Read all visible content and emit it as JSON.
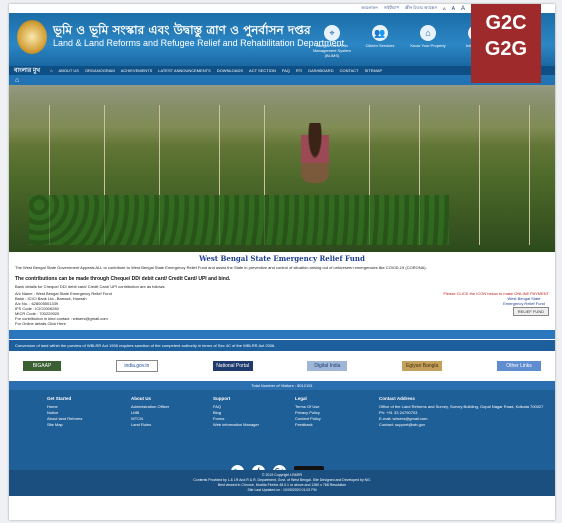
{
  "top_strip": [
    "অবলোকন",
    "সাইটম্যাপ",
    "স্ক্রীন রিডার অ্যাক্সেস",
    "A",
    "A",
    "A"
  ],
  "header": {
    "title_bn": "ভূমি ও ভূমি সংস্কার এবং উদ্বাস্তু ত্রাণ ও পুনর্বাসন দপ্তর",
    "title_en": "Land & Land Reforms and Refugee Relief and Rehabilitation Department",
    "links": [
      {
        "label": "Banglar Land Info Management System (BLIMS)",
        "icon": "map-icon"
      },
      {
        "label": "Citizen Services",
        "icon": "people-icon"
      },
      {
        "label": "Know Your Property",
        "icon": "home-icon"
      },
      {
        "label": "Information",
        "icon": "info-icon"
      }
    ]
  },
  "badge": {
    "line1": "G2C",
    "line2": "G2G"
  },
  "nav": {
    "brand": "বাংলার মুখ",
    "items": [
      "ABOUT US",
      "ORGANOGRAM",
      "ACHIEVEMENTS",
      "LATEST ANNOUNCEMENTS",
      "DOWNLOADS",
      "ACT SECTION",
      "FAQ",
      "RTI",
      "DASHBOARD",
      "CONTACT",
      "SITEMAP"
    ]
  },
  "hero": {
    "caption": "West Bengal State Emergency Relief Fund"
  },
  "relief": {
    "intro": "The West Bengal State Government Appeals ALL to contribute to West Bengal State Emergency Relief Fund and assist the State in preventive and control of situation arising out of unforeseen emergencies like COVID-19 (CORONA).",
    "contrib": "The contributions can be made through Cheque/ DD/ debit card/ Credit Card/ UPI and bind.",
    "bank_head": "Bank details for Cheque/ DD/ debit card/ Credit Card/ UPI contribution are as follows:",
    "bank_lines": [
      "A/c Name   : West Bengal State Emergency Relief Fund",
      "Bank        : ICICI Bank Ltd., Barrack, Howrah",
      "A/c No.     : 628005501339",
      "IFS Code   : ICIC0006280",
      "MICR Code  : 700229020",
      "For contribution in kind contact : wbsers@gmail.com",
      "For Online details Click Here"
    ],
    "online_note": "Please CLICK the ICON below to make ONLINE PAYMENT",
    "online_box": "West Bengal State Emergency Relief Fund",
    "donate_label": "RELIEF FUND"
  },
  "notice": "Conversion of land within the purview of WBLRR Act 1955 requires sanction of the competent authority in terms of Sec 4C of the WBLRR Act 2006.",
  "logos": [
    "BIGAAP",
    "india.gov.in",
    "National Portal",
    "Digital India",
    "Egiyan Bangla",
    "Other Links"
  ],
  "visitors": "Total Number of Visitors : 5012151",
  "footer": {
    "columns": [
      {
        "head": "Get Started",
        "items": [
          "Home",
          "Notice",
          "About land Reforms",
          "Site Map"
        ]
      },
      {
        "head": "About Us",
        "items": [
          "Administration Officer",
          "LMB",
          "WTCN",
          "Land Rules"
        ]
      },
      {
        "head": "Support",
        "items": [
          "FAQ",
          "Blog",
          "Forms",
          "Web information Manager"
        ]
      },
      {
        "head": "Legal",
        "items": [
          "Terms Of Use",
          "Privacy Policy",
          "Content Policy",
          "Feedback"
        ]
      },
      {
        "head": "Contact Address",
        "items": [
          "Office of the Land Reforms and Survey, Survey Building, Gopal Nagar Road, Kolkata 700027",
          "Ph: +91 33 24790703",
          "E-mail: wbsers@gmail.com",
          "Contact: support@wb.gov"
        ]
      }
    ],
    "social": [
      {
        "icon": "twitter-icon",
        "glyph": "🐦"
      },
      {
        "icon": "facebook-icon",
        "glyph": "f"
      },
      {
        "icon": "google-plus-icon",
        "glyph": "G+"
      }
    ],
    "gplay": "Google Play",
    "copyright": "© 2019 Copyright LR&RR",
    "credits": "Contents Provided by L & LR And R & R. Department, Govt. of West Bengal. Site Designed and Developed by NIC",
    "best_view": "Best viewed in Chrome, Mozilla Firefox 48.0.1 or above and 1280 x 768 Resolution",
    "updated": "Site Last Updated on : 10/05/2020 01:02 PM"
  }
}
